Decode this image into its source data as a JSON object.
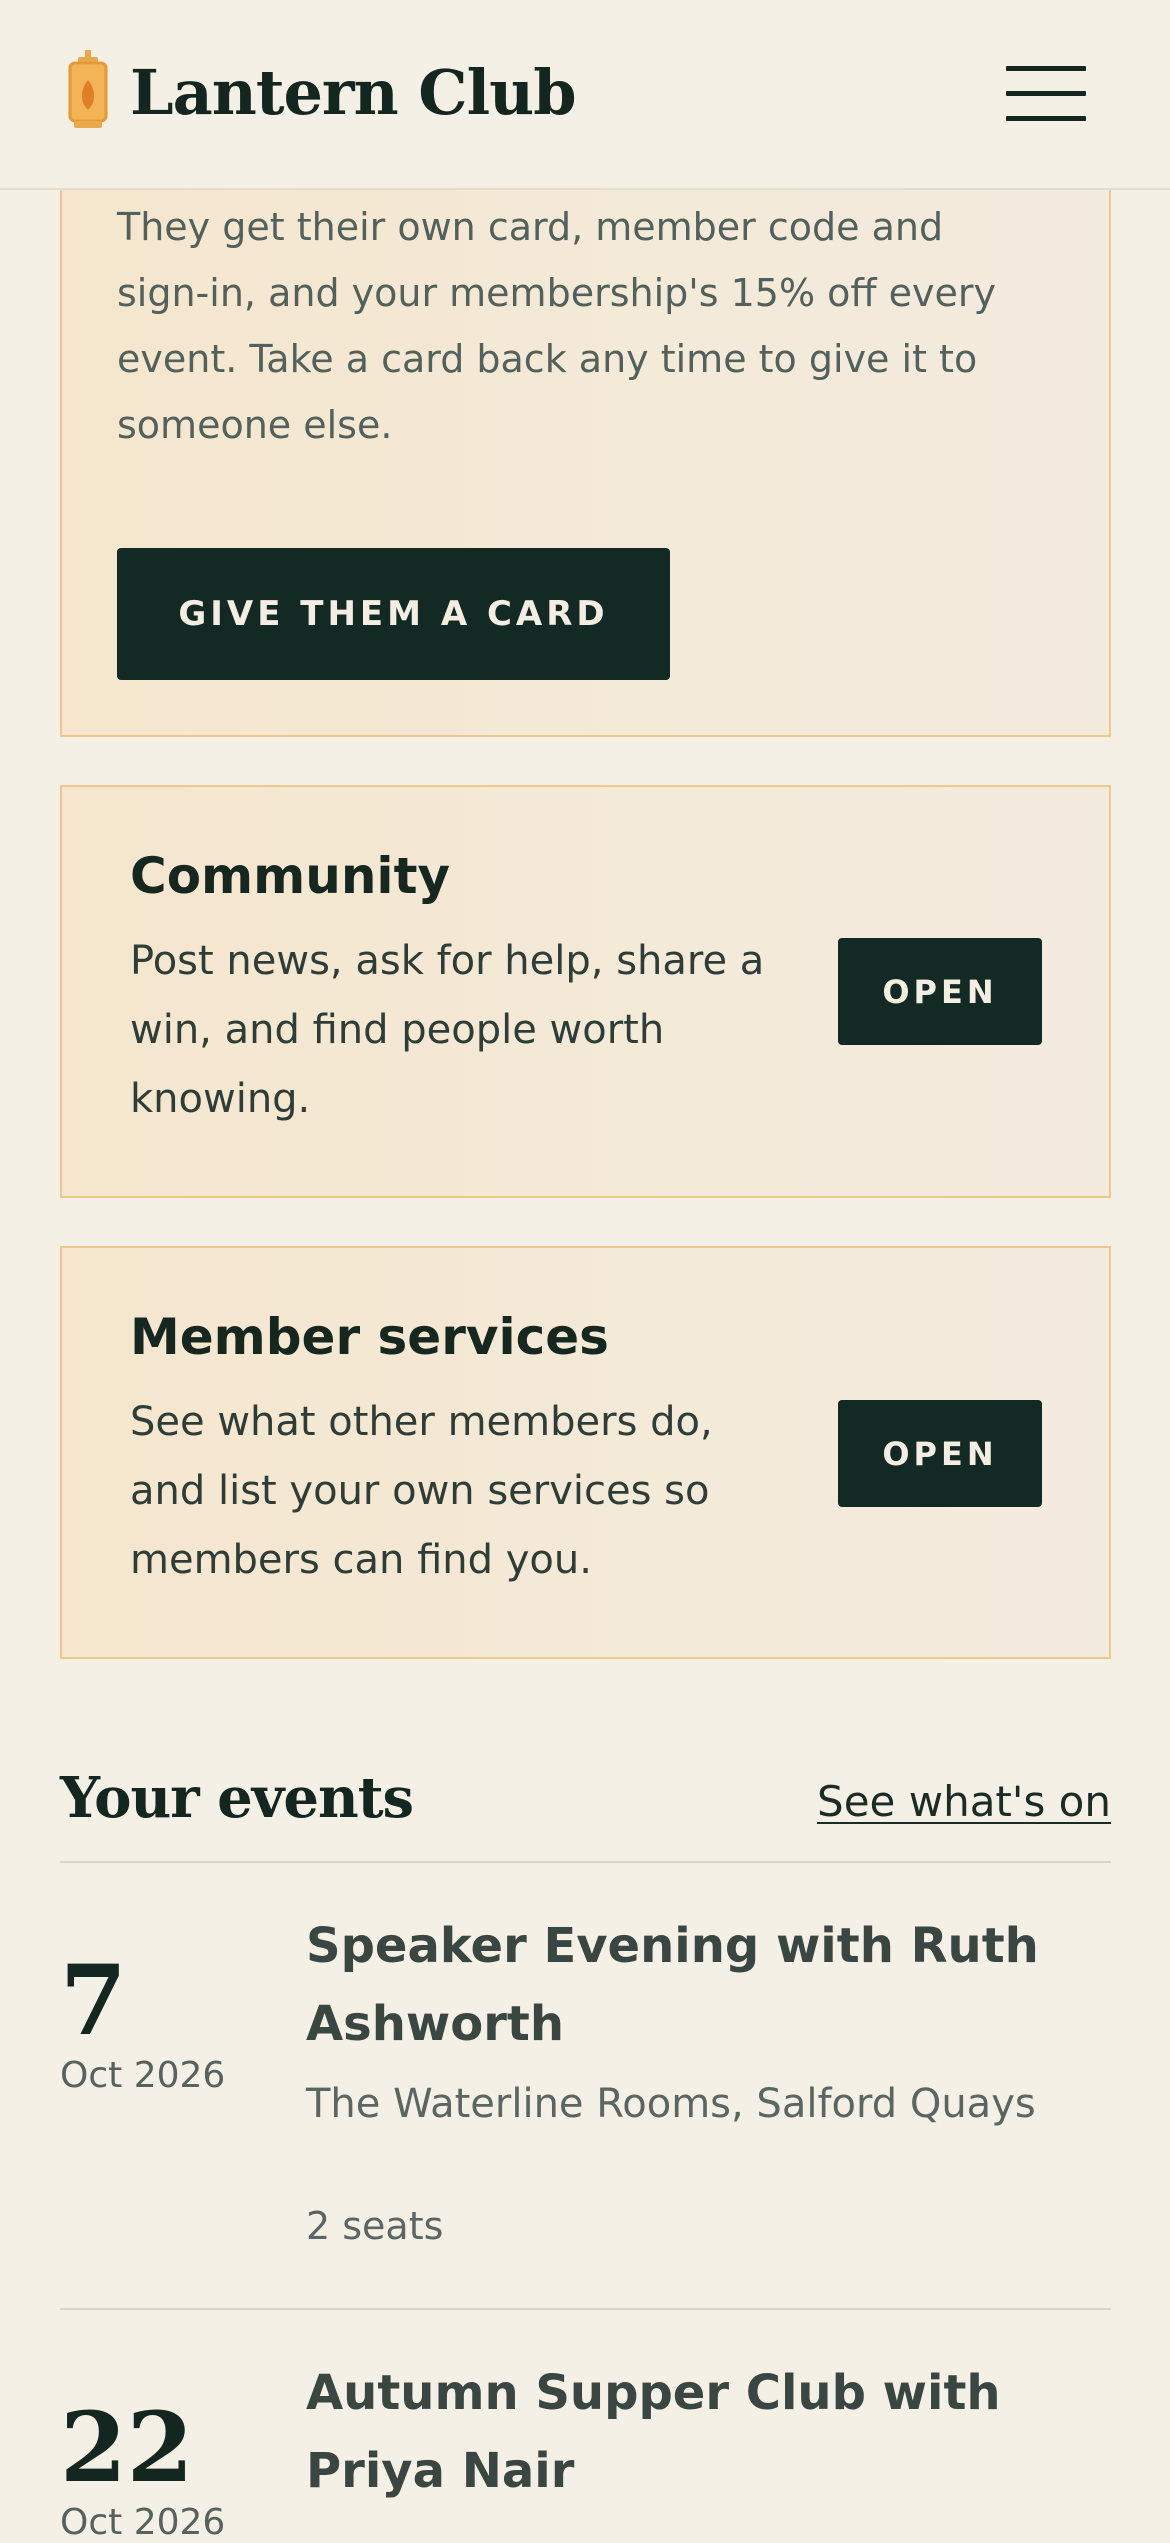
{
  "header": {
    "brand": "Lantern Club",
    "logo_icon": "lantern-icon",
    "menu_icon": "hamburger-menu-icon"
  },
  "gift": {
    "text": "They get their own card, member code and sign-in, and your membership's 15% off every event. Take a card back any time to give it to someone else.",
    "button": "GIVE THEM A CARD"
  },
  "services": [
    {
      "title": "Community",
      "description": "Post news, ask for help, share a win, and find people worth knowing.",
      "button": "OPEN"
    },
    {
      "title": "Member services",
      "description": "See what other members do, and list your own services so members can find you.",
      "button": "OPEN"
    }
  ],
  "events": {
    "title": "Your events",
    "link": "See what's on",
    "items": [
      {
        "day": "7",
        "month": "Oct 2026",
        "title": "Speaker Evening with Ruth Ashworth",
        "venue": "The Waterline Rooms, Salford Quays",
        "seats": "2 seats"
      },
      {
        "day": "22",
        "month": "Oct 2026",
        "title": "Autumn Supper Club with Priya Nair"
      }
    ]
  },
  "colors": {
    "background": "#f4f0e5",
    "dark_green": "#132923",
    "card_border": "#ecc98a",
    "card_fill": "#f5e6cd",
    "lantern_gold": "#e8a94a"
  }
}
